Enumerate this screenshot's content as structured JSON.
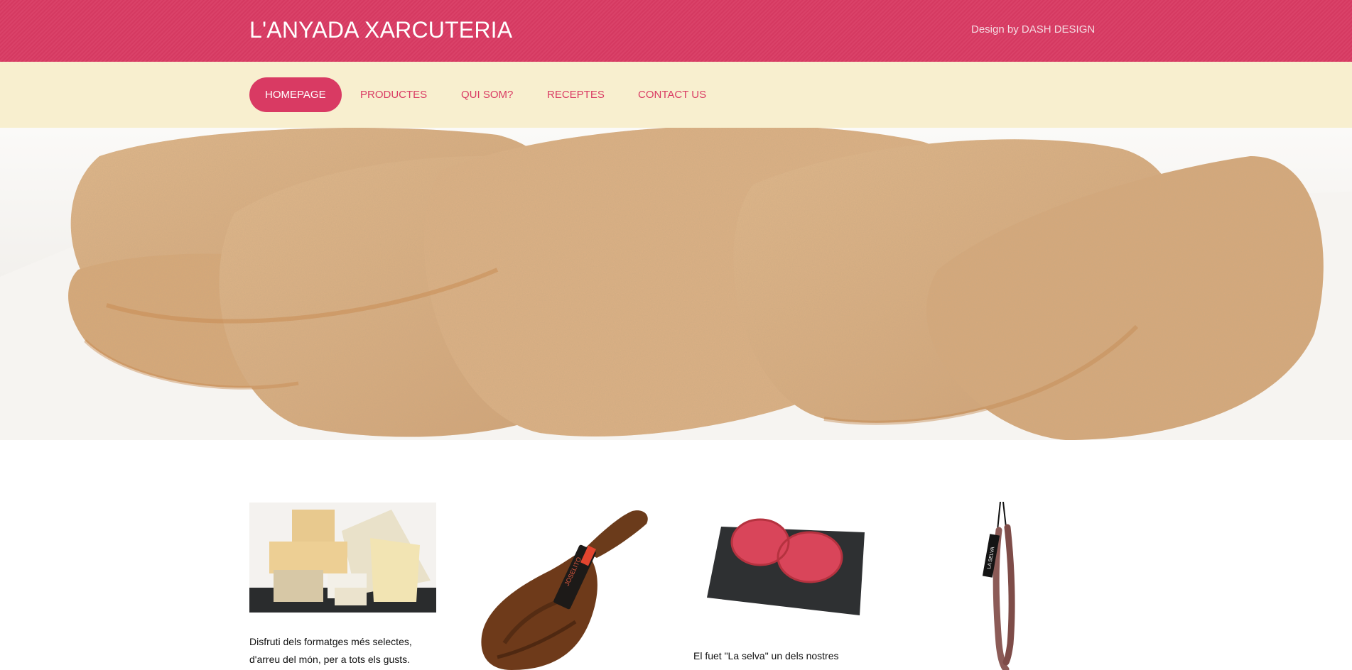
{
  "header": {
    "site_title": "L'ANYADA XARCUTERIA",
    "credit": "Design by DASH DESIGN"
  },
  "nav": {
    "items": [
      {
        "label": "HOMEPAGE",
        "active": true
      },
      {
        "label": "PRODUCTES",
        "active": false
      },
      {
        "label": "QUI SOM?",
        "active": false
      },
      {
        "label": "RECEPTES",
        "active": false
      },
      {
        "label": "CONTACT US",
        "active": false
      }
    ]
  },
  "hero": {
    "image": "breaded-cutlets-photo"
  },
  "products": [
    {
      "image": "cheese-assortment-photo",
      "text_line1": "Disfruti dels formatges més selectes,",
      "text_line2": "d'arreu del món, per a tots els gusts."
    },
    {
      "image": "cured-ham-leg-photo",
      "label_on_image": "JOSELITO"
    },
    {
      "image": "burger-patties-on-slate-photo",
      "text_line1": "El fuet \"La selva\" un dels nostres"
    },
    {
      "image": "hanging-fuet-sausage-photo",
      "label_on_image": "LA SELVA"
    }
  ],
  "colors": {
    "brand": "#d93a63",
    "nav_background": "#f8efcf",
    "header_text": "#ffffff",
    "credit_text": "#f4dbe2"
  }
}
